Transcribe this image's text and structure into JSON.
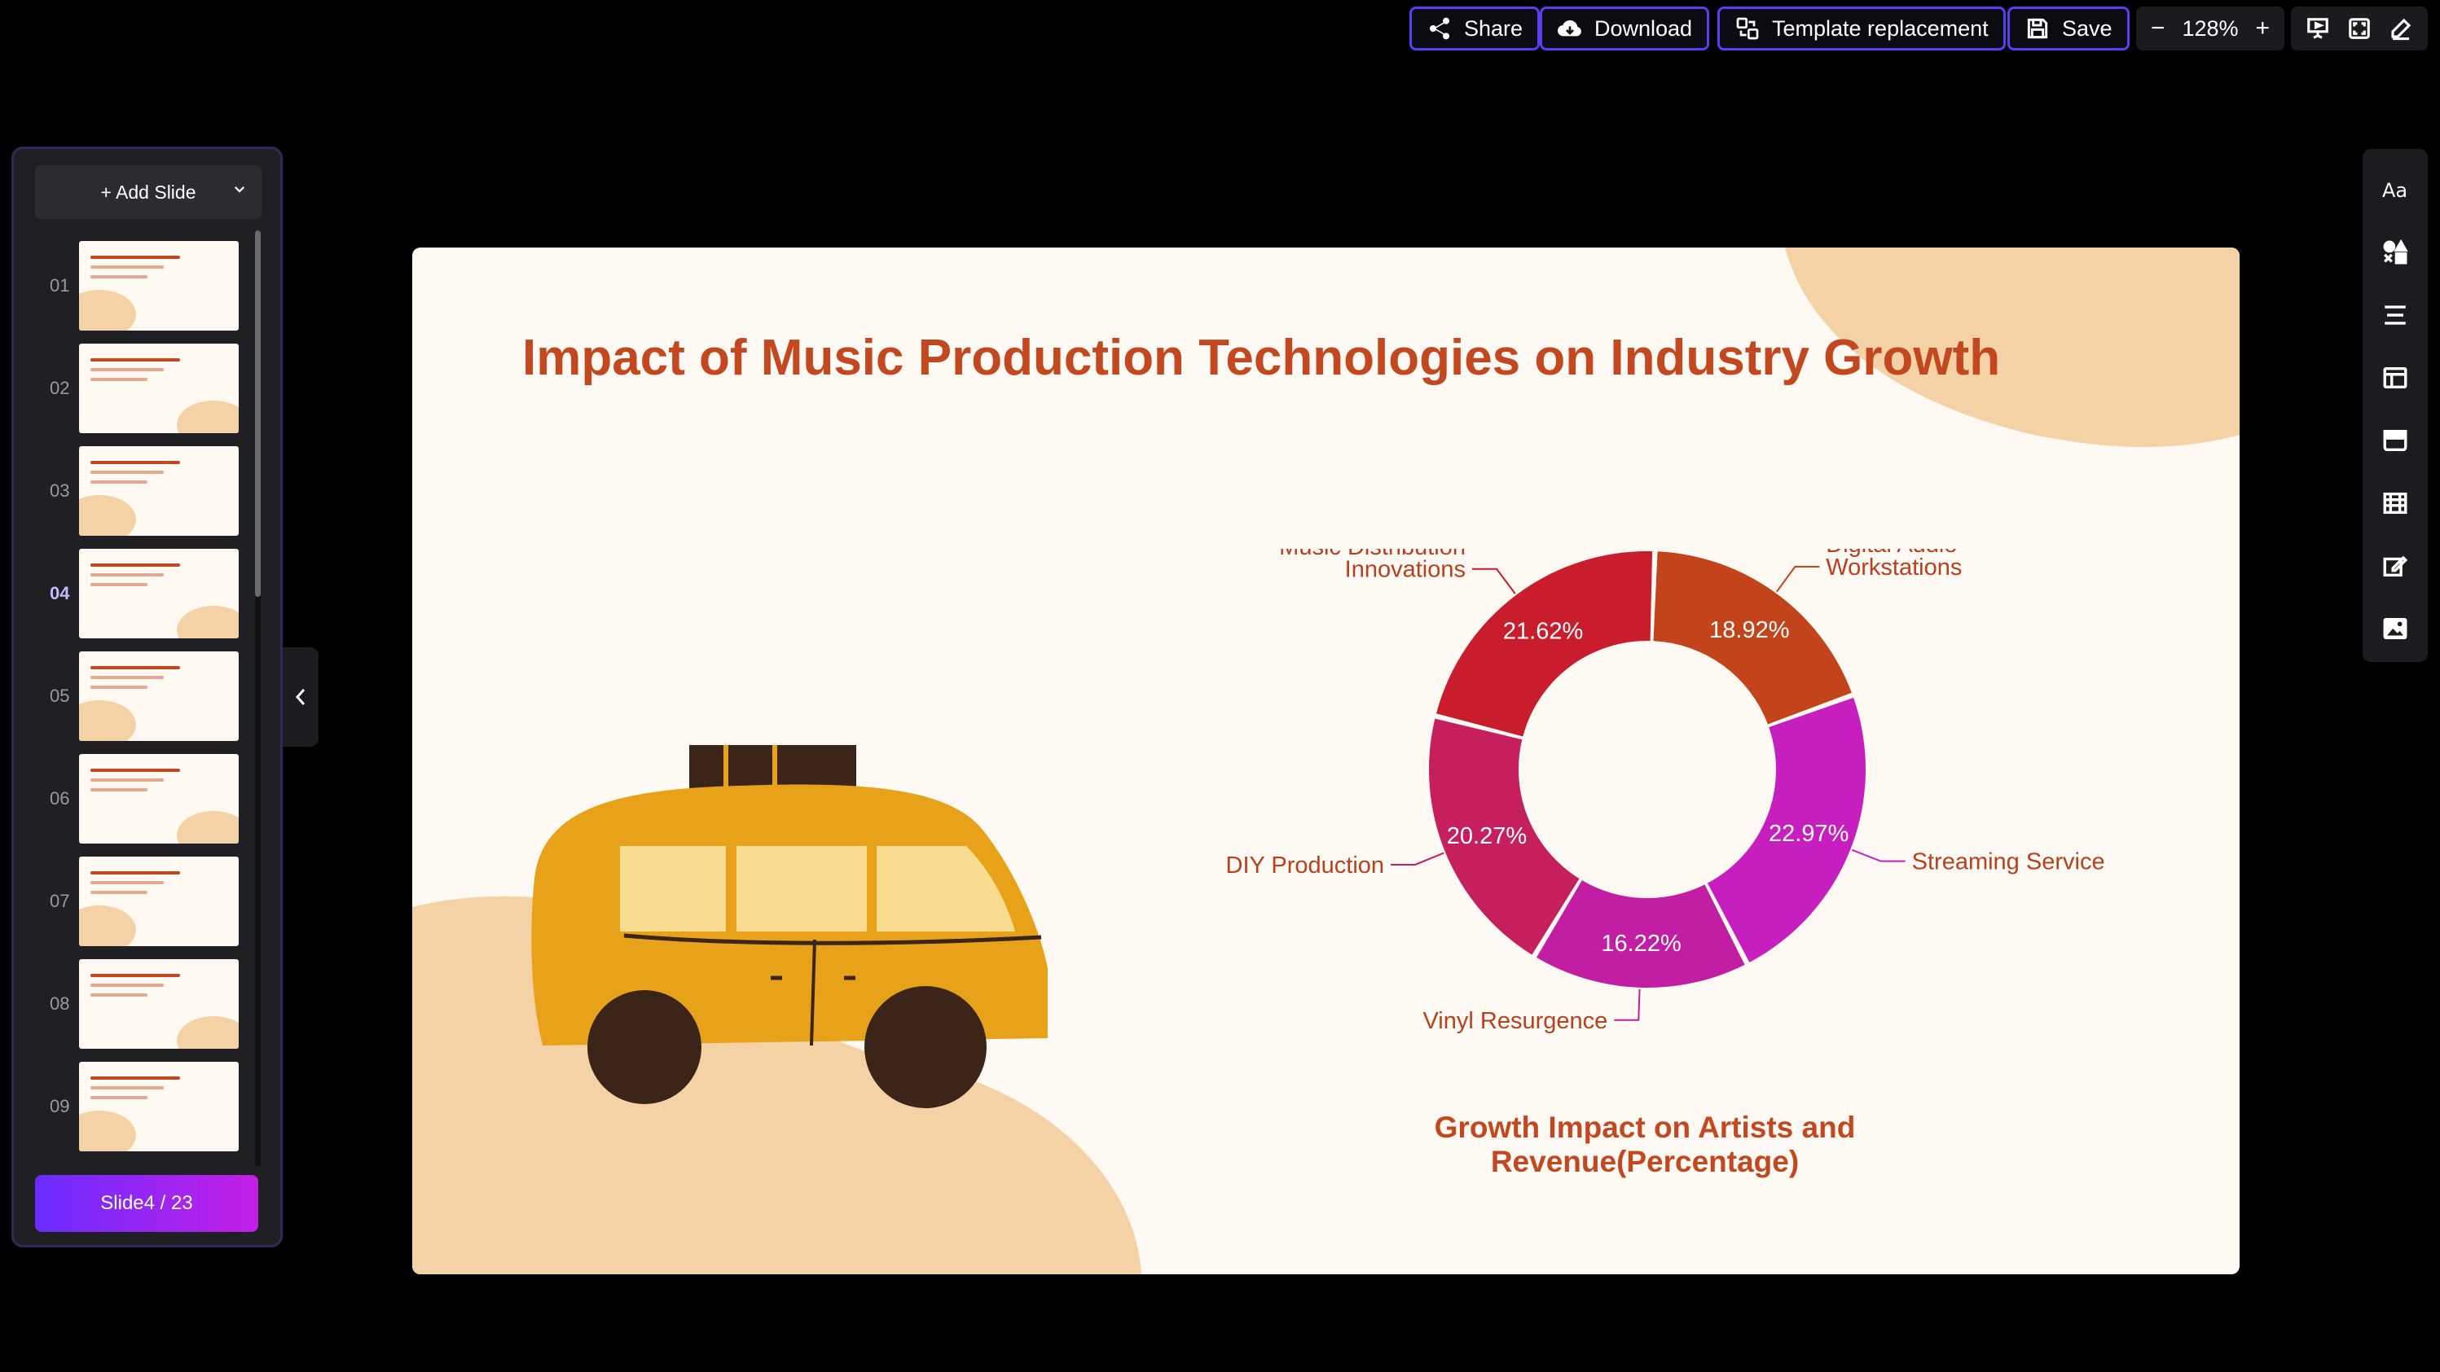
{
  "toolbar": {
    "share": "Share",
    "download": "Download",
    "template_replacement": "Template replacement",
    "save": "Save",
    "zoom_minus": "−",
    "zoom_level": "128%",
    "zoom_plus": "+"
  },
  "left_panel": {
    "add_slide": "+ Add Slide",
    "thumbnails": [
      {
        "num": "01"
      },
      {
        "num": "02"
      },
      {
        "num": "03"
      },
      {
        "num": "04"
      },
      {
        "num": "05"
      },
      {
        "num": "06"
      },
      {
        "num": "07"
      },
      {
        "num": "08"
      },
      {
        "num": "09"
      }
    ],
    "active_index": 3,
    "slide_counter": "Slide4 / 23"
  },
  "right_rail": {
    "icons": [
      "text-style-icon",
      "shapes-icon",
      "align-icon",
      "layout-icon",
      "card-icon",
      "table-icon",
      "edit-icon",
      "image-icon"
    ]
  },
  "slide": {
    "title": "Impact of Music Production Technologies on Industry Growth",
    "chart_caption": "Growth Impact on Artists and Revenue(Percentage)",
    "colors": {
      "title": "#c3471f",
      "background": "#fff9f3",
      "blob": "#f5d2a6",
      "car": "#e8a21a",
      "car_dark": "#3b2418"
    }
  },
  "chart_data": {
    "type": "pie",
    "donut": true,
    "title": "",
    "categories": [
      "Digital Audio Workstations",
      "Streaming Service",
      "Vinyl Resurgence",
      "DIY Production",
      "Music Distribution Innovations"
    ],
    "label_lines": [
      [
        "Digital Audio",
        "Workstations"
      ],
      [
        "Streaming Service"
      ],
      [
        "Vinyl Resurgence"
      ],
      [
        "DIY Production"
      ],
      [
        "Music Distribution",
        "Innovations"
      ]
    ],
    "values": [
      18.92,
      22.97,
      16.22,
      20.27,
      21.62
    ],
    "value_labels": [
      "18.92%",
      "22.97%",
      "16.22%",
      "20.27%",
      "21.62%"
    ],
    "colors": [
      "#c3441a",
      "#c71fbf",
      "#c21ea3",
      "#c51f5e",
      "#c91c2c"
    ]
  }
}
